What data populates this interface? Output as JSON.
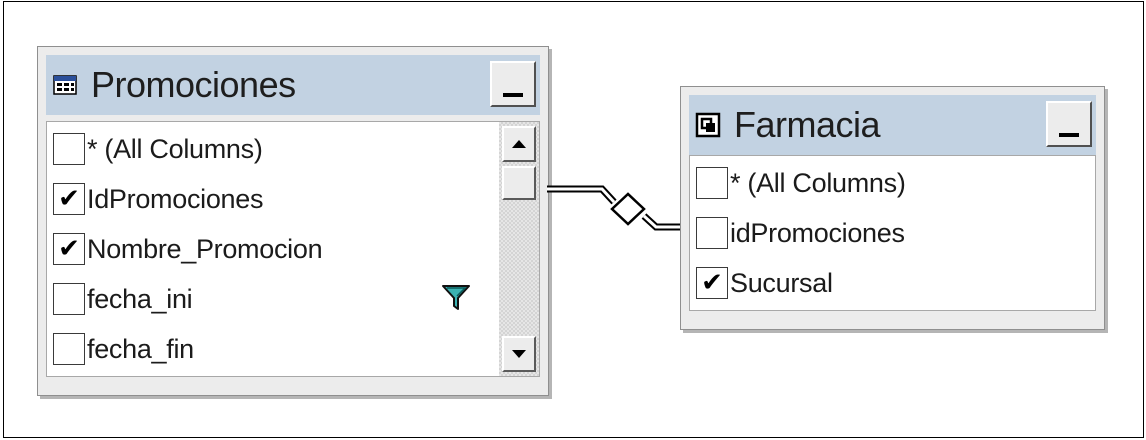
{
  "diagram": {
    "tables": [
      {
        "title": "Promociones",
        "icon": "table-icon",
        "columns": [
          {
            "label": "* (All Columns)",
            "checked": false
          },
          {
            "label": "IdPromociones",
            "checked": true
          },
          {
            "label": "Nombre_Promocion",
            "checked": true
          },
          {
            "label": "fecha_ini",
            "checked": false,
            "filter": true
          },
          {
            "label": "fecha_fin",
            "checked": false
          }
        ]
      },
      {
        "title": "Farmacia",
        "icon": "view-icon",
        "columns": [
          {
            "label": "* (All Columns)",
            "checked": false
          },
          {
            "label": "idPromociones",
            "checked": false
          },
          {
            "label": "Sucursal",
            "checked": true
          }
        ]
      }
    ],
    "join_icon": "diamond-join-icon",
    "check_mark": "✔",
    "colors": {
      "titlebar": "#c2d2e2",
      "window": "#ececec",
      "filter_icon": "#1f8a8a"
    }
  }
}
